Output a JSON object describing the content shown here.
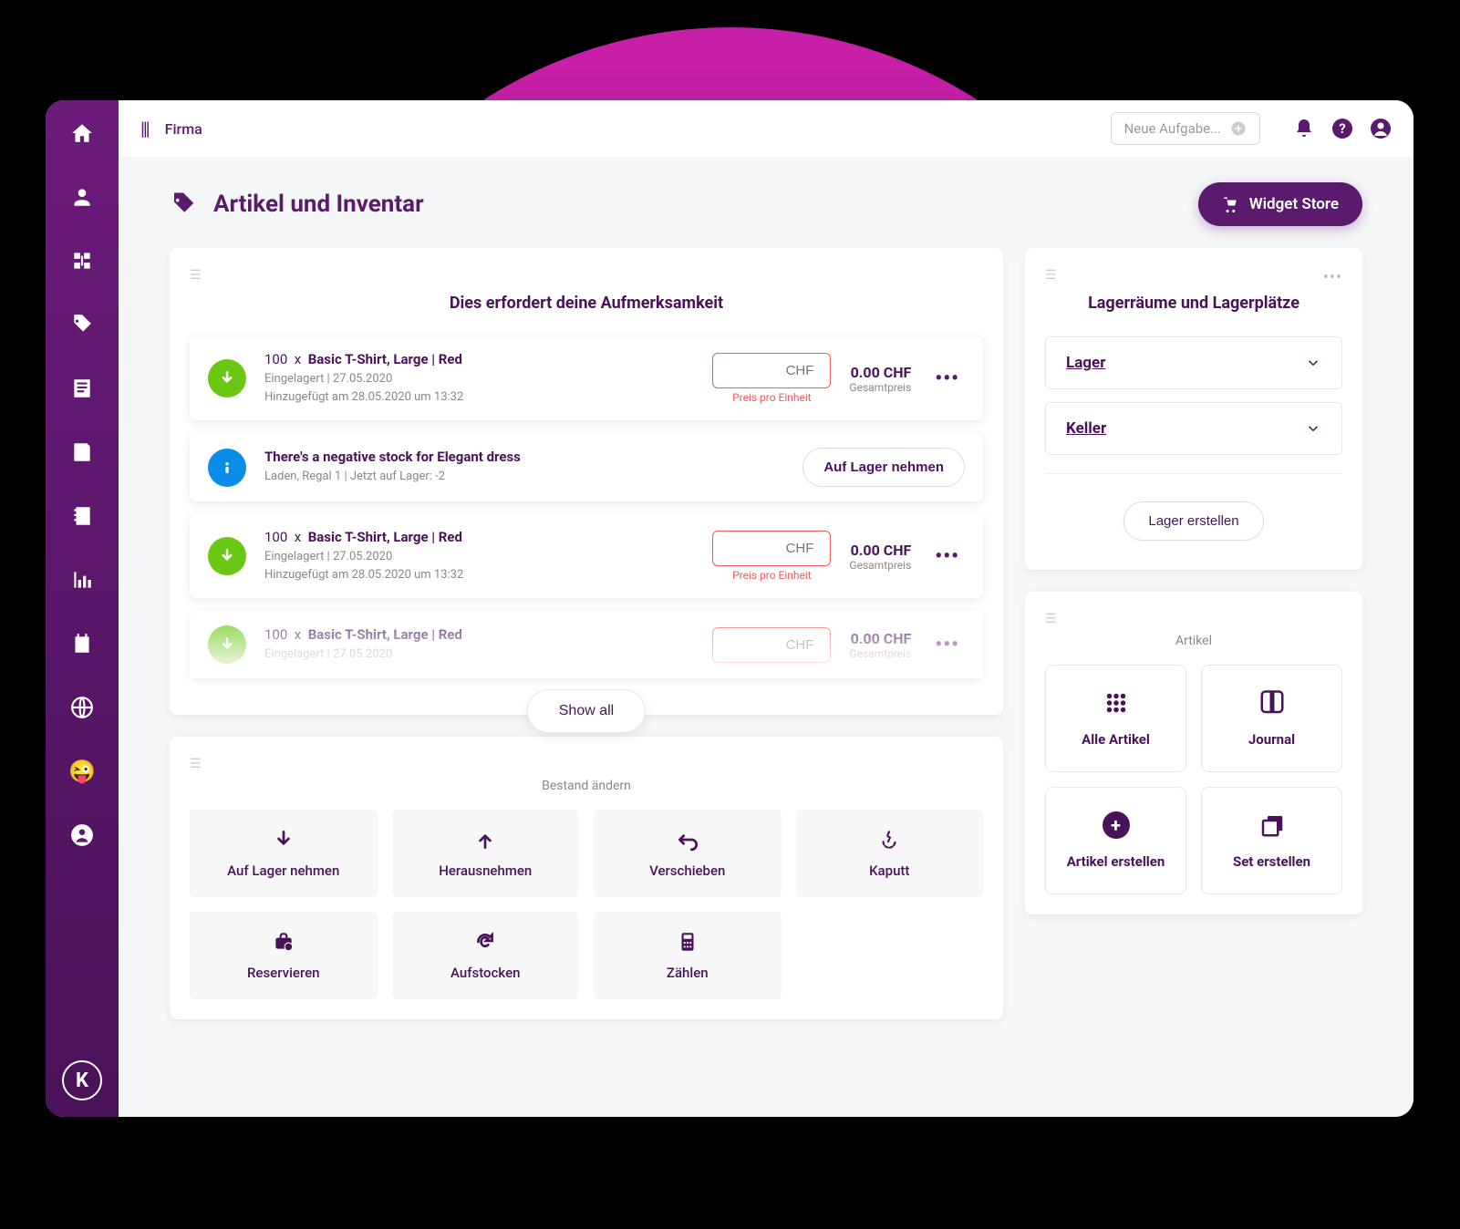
{
  "topbar": {
    "breadcrumb": "Firma",
    "new_task_placeholder": "Neue Aufgabe..."
  },
  "page": {
    "title": "Artikel und Inventar",
    "widget_store_btn": "Widget Store"
  },
  "attention": {
    "title": "Dies erfordert deine Aufmerksamkeit",
    "show_all": "Show all",
    "items": [
      {
        "type": "stock",
        "qty": "100",
        "x": "x",
        "name": "Basic T-Shirt, Large | Red",
        "sub1": "Eingelagert | 27.05.2020",
        "sub2": "Hinzugefügt am 28.05.2020 um 13:32",
        "currency": "CHF",
        "price_hint": "Preis pro Einheit",
        "total": "0.00 CHF",
        "total_label": "Gesamtpreis"
      },
      {
        "type": "warning",
        "title": "There's a negative stock for Elegant dress",
        "sub": "Laden, Regal 1 | Jetzt auf Lager: -2",
        "action": "Auf Lager nehmen"
      },
      {
        "type": "stock",
        "qty": "100",
        "x": "x",
        "name": "Basic T-Shirt, Large | Red",
        "sub1": "Eingelagert | 27.05.2020",
        "sub2": "Hinzugefügt am 28.05.2020 um 13:32",
        "currency": "CHF",
        "price_hint": "Preis pro Einheit",
        "total": "0.00 CHF",
        "total_label": "Gesamtpreis"
      },
      {
        "type": "stock",
        "qty": "100",
        "x": "x",
        "name": "Basic T-Shirt, Large | Red",
        "sub1": "Eingelagert | 27.05.2020",
        "sub2": "",
        "currency": "CHF",
        "price_hint": "",
        "total": "0.00 CHF",
        "total_label": "Gesamtpreis"
      }
    ]
  },
  "change_stock": {
    "title": "Bestand ändern",
    "actions": [
      {
        "label": "Auf Lager nehmen",
        "icon": "arrow-down"
      },
      {
        "label": "Herausnehmen",
        "icon": "arrow-up"
      },
      {
        "label": "Verschieben",
        "icon": "return"
      },
      {
        "label": "Kaputt",
        "icon": "broken"
      },
      {
        "label": "Reservieren",
        "icon": "briefcase"
      },
      {
        "label": "Aufstocken",
        "icon": "refresh"
      },
      {
        "label": "Zählen",
        "icon": "calculator"
      }
    ]
  },
  "storage": {
    "title": "Lagerräume und Lagerplätze",
    "items": [
      "Lager",
      "Keller"
    ],
    "create_btn": "Lager erstellen"
  },
  "articles": {
    "title": "Artikel",
    "tiles": [
      {
        "label": "Alle Artikel",
        "icon": "grid"
      },
      {
        "label": "Journal",
        "icon": "book"
      },
      {
        "label": "Artikel erstellen",
        "icon": "plus"
      },
      {
        "label": "Set erstellen",
        "icon": "stack"
      }
    ]
  }
}
